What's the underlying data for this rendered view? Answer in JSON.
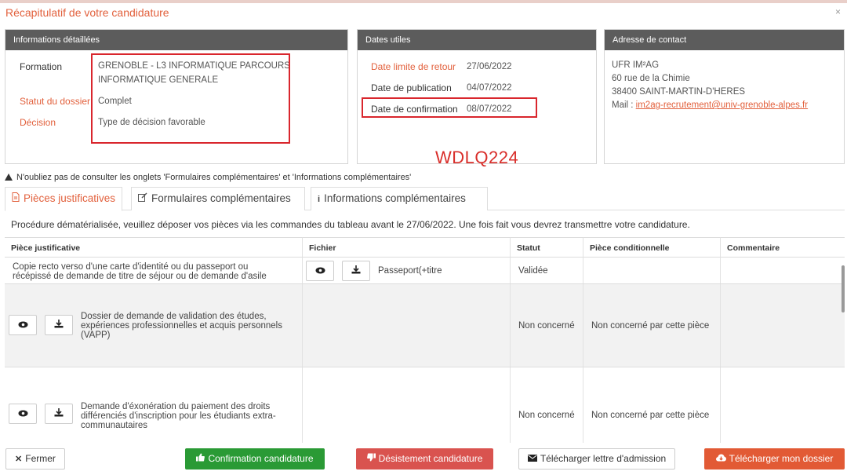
{
  "modal": {
    "title": "Récapitulatif de votre candidature",
    "close": "×"
  },
  "details": {
    "header": "Informations détaillées",
    "formation_label": "Formation",
    "formation_line1": "GRENOBLE - L3 INFORMATIQUE PARCOURS",
    "formation_line2": "INFORMATIQUE GENERALE",
    "status_label": "Statut du dossier",
    "status_value": "Complet",
    "decision_label": "Décision",
    "decision_value": "Type de décision favorable"
  },
  "dates": {
    "header": "Dates utiles",
    "deadline_label": "Date limite de retour",
    "deadline_value": "27/06/2022",
    "publication_label": "Date de publication",
    "publication_value": "04/07/2022",
    "confirmation_label": "Date de confirmation",
    "confirmation_value": "08/07/2022"
  },
  "contact": {
    "header": "Adresse de contact",
    "line1": "UFR IM²AG",
    "line2": "60 rue de la Chimie",
    "line3": "38400 SAINT-MARTIN-D'HERES",
    "mail_label": "Mail : ",
    "mail_value": "im2ag-recrutement@univ-grenoble-alpes.fr"
  },
  "stamp": "WDLQ224",
  "warning": "N'oubliez pas de consulter les onglets 'Formulaires complémentaires' et 'Informations complémentaires'",
  "tabs": [
    {
      "label": "Pièces justificatives",
      "icon": "file-icon"
    },
    {
      "label": "Formulaires complémentaires",
      "icon": "edit-icon"
    },
    {
      "label": "Informations complémentaires",
      "icon": "info-icon"
    }
  ],
  "procedure": "Procédure dématérialisée, veuillez déposer vos pièces via les commandes du tableau avant le 27/06/2022. Une fois fait vous devrez transmettre votre candidature.",
  "table": {
    "headers": [
      "Pièce justificative",
      "Fichier",
      "Statut",
      "Pièce conditionnelle",
      "Commentaire"
    ],
    "rows": [
      {
        "piece_l1": "Copie recto verso d'une carte d'identité ou du passeport ou",
        "piece_l2": "récépissé de demande de titre de séjour ou de demande d'asile",
        "file": "Passeport(+titre",
        "status": "Validée",
        "conditional": "",
        "comment": ""
      },
      {
        "piece_l1": "Dossier de demande de validation des études,",
        "piece_l2": "expériences professionnelles et acquis personnels",
        "piece_l3": "(VAPP)",
        "file": "",
        "status": "Non concerné",
        "conditional": "Non concerné par cette pièce",
        "comment": ""
      },
      {
        "piece_l1": "Demande d'éxonération du paiement des droits",
        "piece_l2": "différenciés d'inscription pour les étudiants extra-",
        "piece_l3": "communautaires",
        "file": "",
        "status": "Non concerné",
        "conditional": "Non concerné par cette pièce",
        "comment": ""
      }
    ]
  },
  "footer": {
    "close": "Fermer",
    "confirm": "Confirmation candidature",
    "desist": "Désistement candidature",
    "letter": "Télécharger lettre d'admission",
    "dossier": "Télécharger mon dossier"
  }
}
